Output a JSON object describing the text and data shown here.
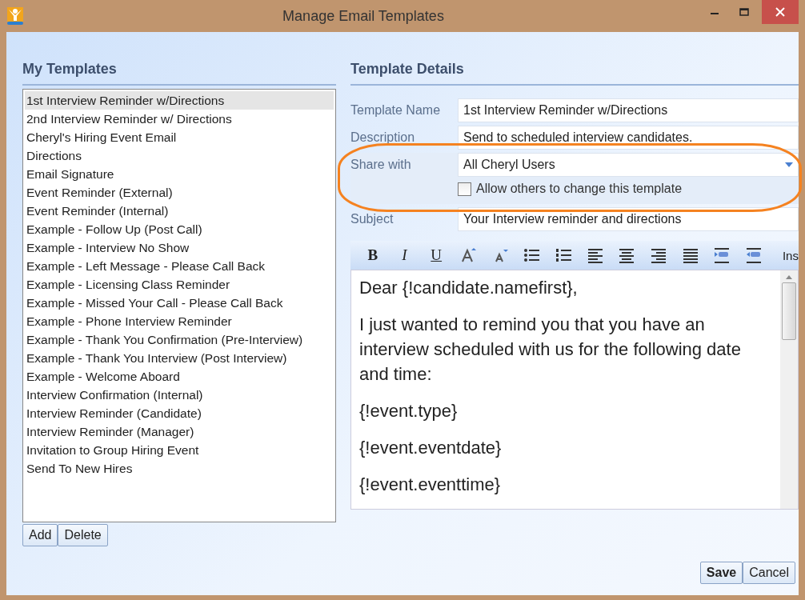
{
  "window": {
    "title": "Manage Email Templates"
  },
  "templates": {
    "heading": "My Templates",
    "items": [
      {
        "label": "1st Interview Reminder w/Directions",
        "selected": true
      },
      {
        "label": "2nd Interview Reminder w/ Directions",
        "selected": false
      },
      {
        "label": "Cheryl's Hiring Event Email",
        "selected": false
      },
      {
        "label": "Directions",
        "selected": false
      },
      {
        "label": "Email Signature",
        "selected": false
      },
      {
        "label": "Event Reminder (External)",
        "selected": false
      },
      {
        "label": "Event Reminder (Internal)",
        "selected": false
      },
      {
        "label": "Example - Follow Up (Post Call)",
        "selected": false
      },
      {
        "label": "Example - Interview No Show",
        "selected": false
      },
      {
        "label": "Example - Left Message - Please Call Back",
        "selected": false
      },
      {
        "label": "Example - Licensing Class Reminder",
        "selected": false
      },
      {
        "label": "Example - Missed Your Call - Please Call Back",
        "selected": false
      },
      {
        "label": "Example - Phone Interview Reminder",
        "selected": false
      },
      {
        "label": "Example - Thank You Confirmation (Pre-Interview)",
        "selected": false
      },
      {
        "label": "Example - Thank You Interview (Post Interview)",
        "selected": false
      },
      {
        "label": "Example - Welcome Aboard",
        "selected": false
      },
      {
        "label": "Interview Confirmation (Internal)",
        "selected": false
      },
      {
        "label": "Interview Reminder (Candidate)",
        "selected": false
      },
      {
        "label": "Interview Reminder (Manager)",
        "selected": false
      },
      {
        "label": "Invitation to Group Hiring Event",
        "selected": false
      },
      {
        "label": "Send To New Hires",
        "selected": false
      }
    ],
    "buttons": [
      "Add",
      "Delete"
    ]
  },
  "details": {
    "heading": "Template Details",
    "name": {
      "label": "Template Name",
      "value": "1st Interview Reminder w/Directions"
    },
    "description": {
      "label": "Description",
      "value": "Send to scheduled interview candidates."
    },
    "share": {
      "label": "Share with",
      "value": "All Cheryl Users",
      "highlighted": true
    },
    "allow_change": {
      "label": "Allow others to change this template",
      "checked": false
    },
    "subject": {
      "label": "Subject",
      "value": "Your Interview reminder and directions"
    },
    "toolbar": [
      {
        "kind": "bold",
        "text": "B"
      },
      {
        "kind": "italic",
        "text": "I"
      },
      {
        "kind": "underline",
        "text": "U"
      },
      {
        "kind": "grow"
      },
      {
        "kind": "shrink"
      },
      {
        "kind": "bullets"
      },
      {
        "kind": "numbers"
      },
      {
        "kind": "left"
      },
      {
        "kind": "center"
      },
      {
        "kind": "right"
      },
      {
        "kind": "justify"
      },
      {
        "kind": "indent"
      },
      {
        "kind": "outdent"
      },
      {
        "kind": "label",
        "text": "Ins"
      }
    ],
    "body": [
      "Dear {!candidate.namefirst},",
      "I just wanted to remind you that you have an interview scheduled with us for the following date and time:",
      "{!event.type}",
      "{!event.eventdate}",
      "{!event.eventtime}"
    ]
  },
  "buttons": [
    {
      "label": "Save",
      "default": true
    },
    {
      "label": "Cancel",
      "default": false
    }
  ]
}
